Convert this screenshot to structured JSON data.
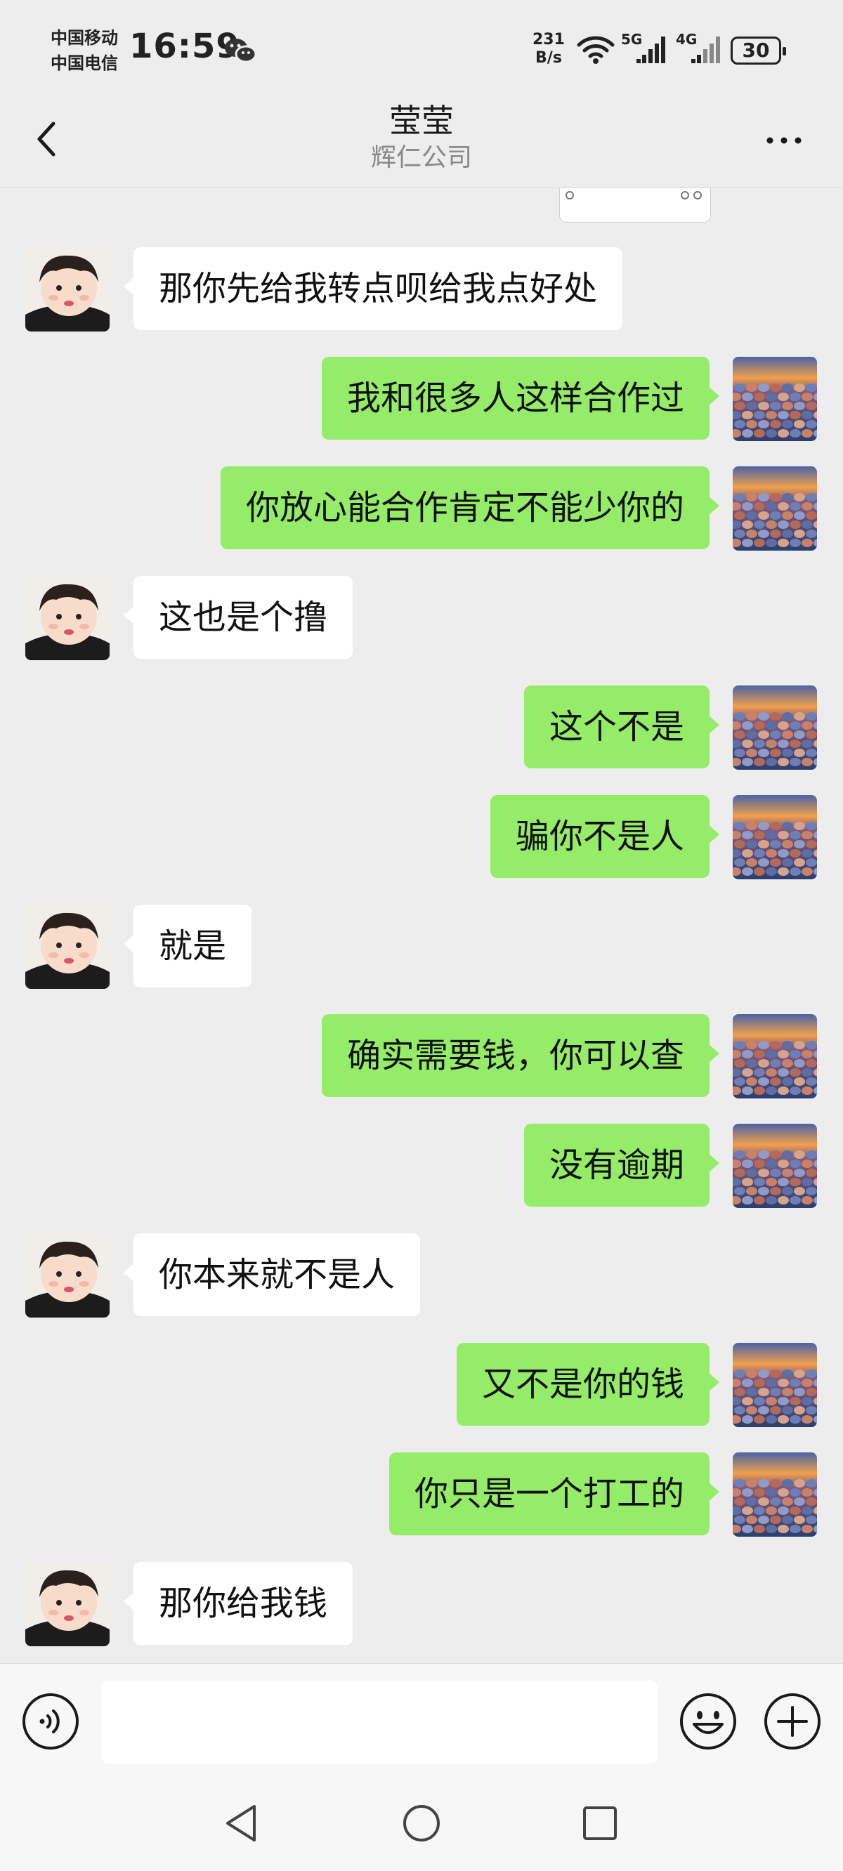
{
  "status_bar": {
    "carrier_1": "中国移动",
    "carrier_2": "中国电信",
    "time": "16:59",
    "net_speed_value": "231",
    "net_speed_unit": "B/s",
    "signal_1": "5G",
    "signal_2": "4G",
    "battery": "30"
  },
  "header": {
    "title": "莹莹",
    "subtitle": "辉仁公司"
  },
  "messages": [
    {
      "side": "left",
      "text": "那你先给我转点呗给我点好处"
    },
    {
      "side": "right",
      "text": "我和很多人这样合作过"
    },
    {
      "side": "right",
      "text": "你放心能合作肯定不能少你的"
    },
    {
      "side": "left",
      "text": "这也是个撸"
    },
    {
      "side": "right",
      "text": "这个不是"
    },
    {
      "side": "right",
      "text": "骗你不是人"
    },
    {
      "side": "left",
      "text": "就是"
    },
    {
      "side": "right",
      "text": "确实需要钱，你可以查"
    },
    {
      "side": "right",
      "text": "没有逾期"
    },
    {
      "side": "left",
      "text": "你本来就不是人"
    },
    {
      "side": "right",
      "text": "又不是你的钱"
    },
    {
      "side": "right",
      "text": "你只是一个打工的"
    },
    {
      "side": "left",
      "text": "那你给我钱"
    }
  ],
  "input": {
    "value": "",
    "placeholder": ""
  },
  "colors": {
    "background": "#ededed",
    "bubble_sent": "#95ec69",
    "bubble_received": "#ffffff"
  },
  "icons": {
    "back": "chevron-left-icon",
    "more": "more-dots-icon",
    "voice": "voice-icon",
    "emoji": "emoji-icon",
    "plus": "plus-icon",
    "system_back": "triangle-back-icon",
    "system_home": "circle-home-icon",
    "system_recent": "square-recent-icon"
  }
}
